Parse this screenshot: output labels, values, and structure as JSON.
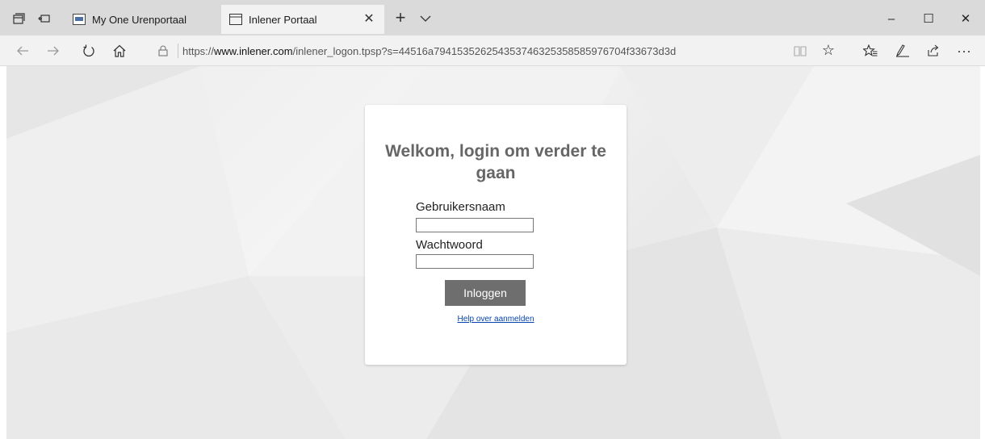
{
  "browser": {
    "tabs": [
      {
        "label": "My One Urenportaal",
        "active": false
      },
      {
        "label": "Inlener Portaal",
        "active": true
      }
    ],
    "new_tab_glyph": "+",
    "close_glyph": "✕",
    "window_controls": {
      "minimize": "–",
      "maximize": "☐",
      "close": "✕"
    },
    "address": {
      "scheme": "https://",
      "host": "www.inlener.com",
      "path": "/inlener_logon.tpsp?s=44516a794153526254353746325358585976704f33673d3d"
    },
    "more_glyph": "···",
    "icons": {
      "tab_actions": "set-aside-tabs-icon",
      "tab_preview": "show-tabs-icon",
      "back": "back-arrow-icon",
      "forward": "forward-arrow-icon",
      "refresh": "refresh-icon",
      "home": "home-icon",
      "lock": "lock-icon",
      "reading_view": "reading-view-icon",
      "favorite": "star-icon",
      "favorites_hub": "favorites-list-icon",
      "notes": "pen-icon",
      "share": "share-icon",
      "more": "more-icon"
    }
  },
  "login": {
    "title": "Welkom, login om verder te gaan",
    "username_label": "Gebruikersnaam",
    "username_value": "",
    "password_label": "Wachtwoord",
    "password_value": "",
    "submit_label": "Inloggen",
    "help_link": "Help over aanmelden"
  },
  "colors": {
    "tab_strip": "#dadada",
    "active_tab": "#f2f2f2",
    "button_bg": "#6e6e6e",
    "title": "#666666",
    "link": "#0645ad"
  }
}
